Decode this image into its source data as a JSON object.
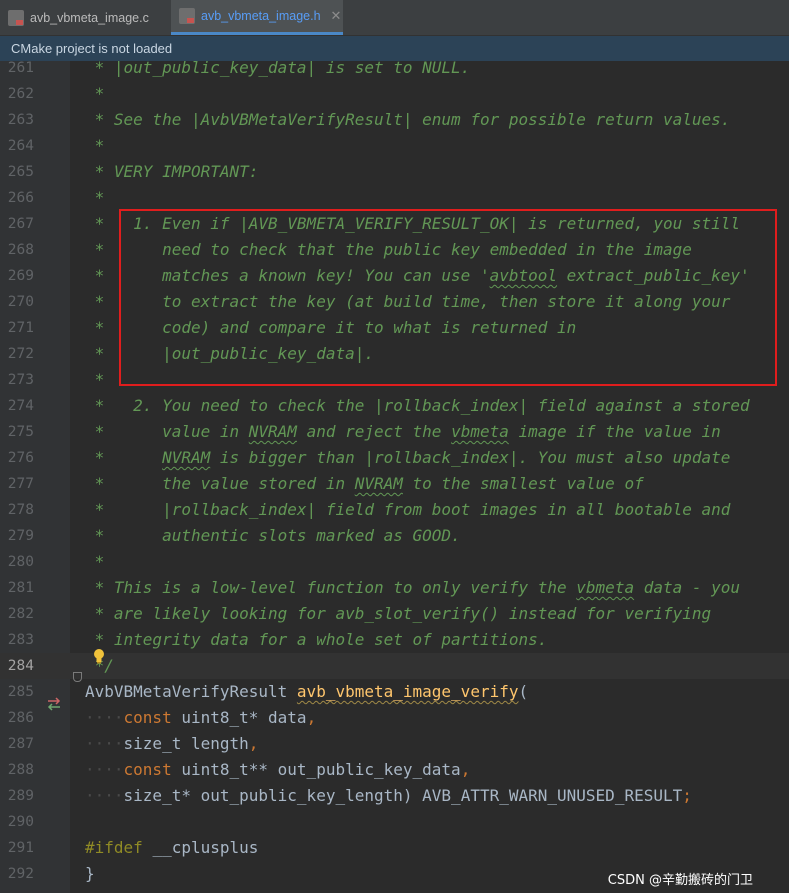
{
  "tabs": [
    {
      "label": "avb_vbmeta_image.c",
      "active": false
    },
    {
      "label": "avb_vbmeta_image.h",
      "active": true
    }
  ],
  "banner": {
    "text": "CMake project is not loaded"
  },
  "lines": [
    {
      "n": "261",
      "kind": "c",
      "text": " * |out_public_key_data| is set to NULL."
    },
    {
      "n": "262",
      "kind": "c",
      "text": " *"
    },
    {
      "n": "263",
      "kind": "c",
      "text": " * See the |AvbVBMetaVerifyResult| enum for possible return values."
    },
    {
      "n": "264",
      "kind": "c",
      "text": " *"
    },
    {
      "n": "265",
      "kind": "c",
      "text": " * VERY IMPORTANT:"
    },
    {
      "n": "266",
      "kind": "c",
      "text": " *"
    },
    {
      "n": "267",
      "kind": "c",
      "text": " *   1. Even if |AVB_VBMETA_VERIFY_RESULT_OK| is returned, you still"
    },
    {
      "n": "268",
      "kind": "c",
      "text": " *      need to check that the public key embedded in the image"
    },
    {
      "n": "269",
      "kind": "c",
      "text": " *      matches a known key! You can use 'avbtool extract_public_key'"
    },
    {
      "n": "270",
      "kind": "c",
      "text": " *      to extract the key (at build time, then store it along your"
    },
    {
      "n": "271",
      "kind": "c",
      "text": " *      code) and compare it to what is returned in"
    },
    {
      "n": "272",
      "kind": "c",
      "text": " *      |out_public_key_data|."
    },
    {
      "n": "273",
      "kind": "c",
      "text": " *"
    },
    {
      "n": "274",
      "kind": "c",
      "text": " *   2. You need to check the |rollback_index| field against a stored"
    },
    {
      "n": "275",
      "kind": "c",
      "text": " *      value in NVRAM and reject the vbmeta image if the value in"
    },
    {
      "n": "276",
      "kind": "c",
      "text": " *      NVRAM is bigger than |rollback_index|. You must also update"
    },
    {
      "n": "277",
      "kind": "c",
      "text": " *      the value stored in NVRAM to the smallest value of"
    },
    {
      "n": "278",
      "kind": "c",
      "text": " *      |rollback_index| field from boot images in all bootable and"
    },
    {
      "n": "279",
      "kind": "c",
      "text": " *      authentic slots marked as GOOD."
    },
    {
      "n": "280",
      "kind": "c",
      "text": " *"
    },
    {
      "n": "281",
      "kind": "c",
      "text": " * This is a low-level function to only verify the vbmeta data - you"
    },
    {
      "n": "282",
      "kind": "c",
      "text": " * are likely looking for avb_slot_verify() instead for verifying"
    },
    {
      "n": "283",
      "kind": "c",
      "text": " * integrity data for a whole set of partitions."
    },
    {
      "n": "284",
      "kind": "c",
      "text": " */",
      "current": true
    },
    {
      "n": "285",
      "kind": "code",
      "tokens": [
        {
          "t": "AvbVBMetaVerifyResult ",
          "c": "pl"
        },
        {
          "t": "avb_vbmeta_image_verify",
          "c": "fn"
        },
        {
          "t": "(",
          "c": "pl"
        }
      ]
    },
    {
      "n": "286",
      "kind": "code",
      "tokens": [
        {
          "t": "    ",
          "c": "ws"
        },
        {
          "t": "const ",
          "c": "kw"
        },
        {
          "t": "uint8_t* data",
          "c": "pl"
        },
        {
          "t": ",",
          "c": "pu"
        }
      ]
    },
    {
      "n": "287",
      "kind": "code",
      "tokens": [
        {
          "t": "    ",
          "c": "ws"
        },
        {
          "t": "size_t length",
          "c": "pl"
        },
        {
          "t": ",",
          "c": "pu"
        }
      ]
    },
    {
      "n": "288",
      "kind": "code",
      "tokens": [
        {
          "t": "    ",
          "c": "ws"
        },
        {
          "t": "const ",
          "c": "kw"
        },
        {
          "t": "uint8_t** out_public_key_data",
          "c": "pl"
        },
        {
          "t": ",",
          "c": "pu"
        }
      ]
    },
    {
      "n": "289",
      "kind": "code",
      "tokens": [
        {
          "t": "    ",
          "c": "ws"
        },
        {
          "t": "size_t* out_public_key_length) ",
          "c": "pl"
        },
        {
          "t": "AVB_ATTR_WARN_UNUSED_RESULT",
          "c": "dim"
        },
        {
          "t": ";",
          "c": "pu"
        }
      ]
    },
    {
      "n": "290",
      "kind": "code",
      "tokens": []
    },
    {
      "n": "291",
      "kind": "code",
      "tokens": [
        {
          "t": "#ifdef ",
          "c": "mac"
        },
        {
          "t": "__cplusplus",
          "c": "pl"
        }
      ]
    },
    {
      "n": "292",
      "kind": "code",
      "tokens": [
        {
          "t": "}",
          "c": "pl"
        }
      ]
    }
  ],
  "watermark": "CSDN @辛勤搬砖的门卫",
  "colors": {
    "comment": "#629755",
    "keyword": "#cc7832",
    "function": "#ffc66d",
    "highlight_box": "#e01d1d"
  }
}
